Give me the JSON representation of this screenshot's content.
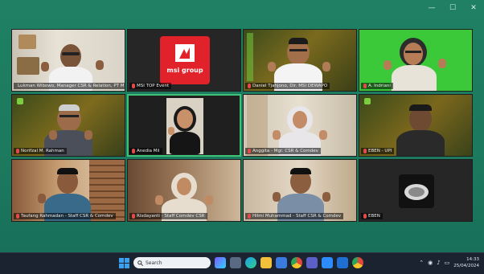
{
  "window": {
    "controls": [
      {
        "name": "minimize-button",
        "glyph": "—"
      },
      {
        "name": "maximize-button",
        "glyph": "☐"
      },
      {
        "name": "close-button",
        "glyph": "✕"
      }
    ]
  },
  "participants": [
    {
      "label": "Lukman Wibowo, Manager CSR & Relation, PT MSI"
    },
    {
      "label": "MSI TOP Event"
    },
    {
      "label": "Daniel Tjahjono, Dir. MSI DEWAPO"
    },
    {
      "label": "A. Indriani"
    },
    {
      "label": "Norifzal M. Rahman"
    },
    {
      "label": "Anedia Mil"
    },
    {
      "label": "Anggita - Mgr. CSR & Comdev"
    },
    {
      "label": "EBEN - UPI"
    },
    {
      "label": "Taufang Rahmadan - Staff CSR & Comdev"
    },
    {
      "label": "Risdayanti - Staff Comdev CSR"
    },
    {
      "label": "Hilmi Muhammad - Staff CSR & Comdev"
    },
    {
      "label": "EBEN"
    }
  ],
  "logo_tile": {
    "brand_text": "msi group"
  },
  "taskbar": {
    "search_placeholder": "Search",
    "time": "14:33",
    "date": "25/04/2024"
  }
}
